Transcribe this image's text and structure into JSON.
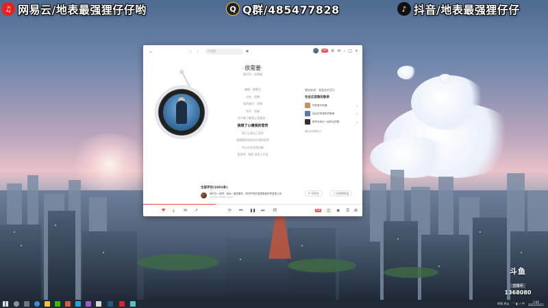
{
  "overlays": {
    "left": "网易云/地表最强狸仔仔哟",
    "center": "Q群/485477828",
    "right": "抖音/地表最强狸仔仔"
  },
  "player": {
    "search_placeholder": "Q 搜索",
    "song_title": "很需要",
    "song_subtitle": "狸仔仔 - 很需要",
    "lyrics": [
      "编曲：柳重言",
      "吉他：屈霄",
      "和声编写：屈霄",
      "和声：屈霄",
      "你不够了解我让我更加...",
      "我想了心痛我的悲伤",
      "我已让我自己怎样",
      "我需要你的陪伴在我的身旁",
      "所以在这里我也被",
      "录音师：陈毅 录音工作室"
    ],
    "active_lyric_index": 5,
    "side": {
      "lines": [
        "播放来源：我喜欢的音乐"
      ],
      "similar_header": "包含这首歌的歌单",
      "similar": [
        "你的音乐收藏",
        "适合在夜里听的歌单",
        "那些年我们一起听过的歌"
      ],
      "more_link": "喜欢这首歌的人"
    },
    "comments_header": "全部评论(2401条)",
    "comment": {
      "text": "我们在一起吧，我会一直陪着你，愿你所有的温柔都被世界温柔以待",
      "time": "2022年10月18日 18:20"
    },
    "buttons": {
      "write_comment": "写评论",
      "share": "分享给好友"
    },
    "hq_badge": "极高",
    "progress": 0.33
  },
  "douyu": {
    "brand": "斗鱼",
    "sub": "直播间",
    "room": "1368080"
  },
  "taskbar": {
    "weather": "阵雨 多云",
    "time": "1:06",
    "date": "2022/10/21"
  },
  "colors": {
    "accent": "#ec4141",
    "taskbar": "#202a35"
  }
}
